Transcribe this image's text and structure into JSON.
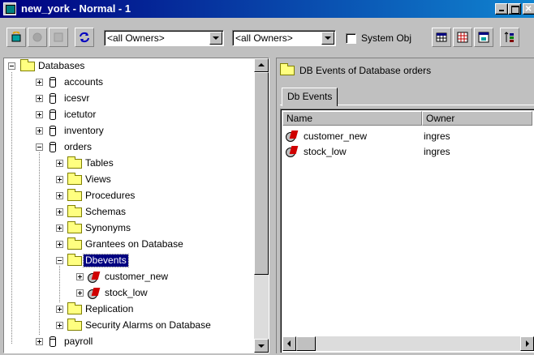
{
  "window": {
    "title": "new_york - Normal - 1"
  },
  "toolbar": {
    "owners_filter_1": "<all Owners>",
    "owners_filter_2": "<all Owners>",
    "system_obj_label": "System Obj",
    "system_obj_checked": false
  },
  "tree": {
    "root": "Databases",
    "databases": [
      "accounts",
      "icesvr",
      "icetutor",
      "inventory",
      "orders",
      "payroll"
    ],
    "orders_children": [
      "Tables",
      "Views",
      "Procedures",
      "Schemas",
      "Synonyms",
      "Grantees on Database",
      "Dbevents",
      "Replication",
      "Security Alarms on Database"
    ],
    "dbevents": [
      "customer_new",
      "stock_low"
    ],
    "selected": "Dbevents"
  },
  "detail": {
    "header": "DB Events of Database  orders",
    "tab": "Db Events",
    "columns": [
      "Name",
      "Owner"
    ],
    "rows": [
      {
        "name": "customer_new",
        "owner": "ingres"
      },
      {
        "name": "stock_low",
        "owner": "ingres"
      }
    ]
  }
}
